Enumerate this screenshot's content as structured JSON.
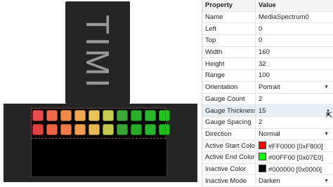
{
  "device": {
    "logo_text": "TIMI"
  },
  "spectrum": {
    "rows": [
      [
        "#e94a4a",
        "#ee6a4a",
        "#f08a4a",
        "#f0a850",
        "#e8c458",
        "#c8cc50",
        "#3aa838",
        "#28b02a",
        "#2ab82a",
        "#22c022"
      ],
      [
        "#e44040",
        "#ec6044",
        "#f07a48",
        "#f09a4c",
        "#e8b852",
        "#c4c84c",
        "#38a434",
        "#26ac26",
        "#28b428",
        "#20bc20"
      ]
    ]
  },
  "inspector": {
    "header": {
      "property": "Property",
      "value": "Value"
    },
    "rows": [
      {
        "name": "Name",
        "value": "MediaSpectrum0"
      },
      {
        "name": "Left",
        "value": "0"
      },
      {
        "name": "Top",
        "value": "0"
      },
      {
        "name": "Width",
        "value": "160"
      },
      {
        "name": "Height",
        "value": "32"
      },
      {
        "name": "Range",
        "value": "100"
      },
      {
        "name": "Orientation",
        "value": "Portrait"
      },
      {
        "name": "Gauge Count",
        "value": "2"
      },
      {
        "name": "Gauge Thickness",
        "value": "15"
      },
      {
        "name": "Gauge Spacing",
        "value": "2"
      },
      {
        "name": "Direction",
        "value": "Normal"
      },
      {
        "name": "Active Start Color",
        "value": "#FF0000 [0xF800]",
        "color": "#ff0000"
      },
      {
        "name": "Active End Color",
        "value": "#00FF00 [0x07E0]",
        "color": "#00ff00"
      },
      {
        "name": "Inactive Color",
        "value": "#000000 [0x0000]",
        "color": "#000000"
      },
      {
        "name": "Inactive Mode",
        "value": "Darken"
      }
    ]
  }
}
